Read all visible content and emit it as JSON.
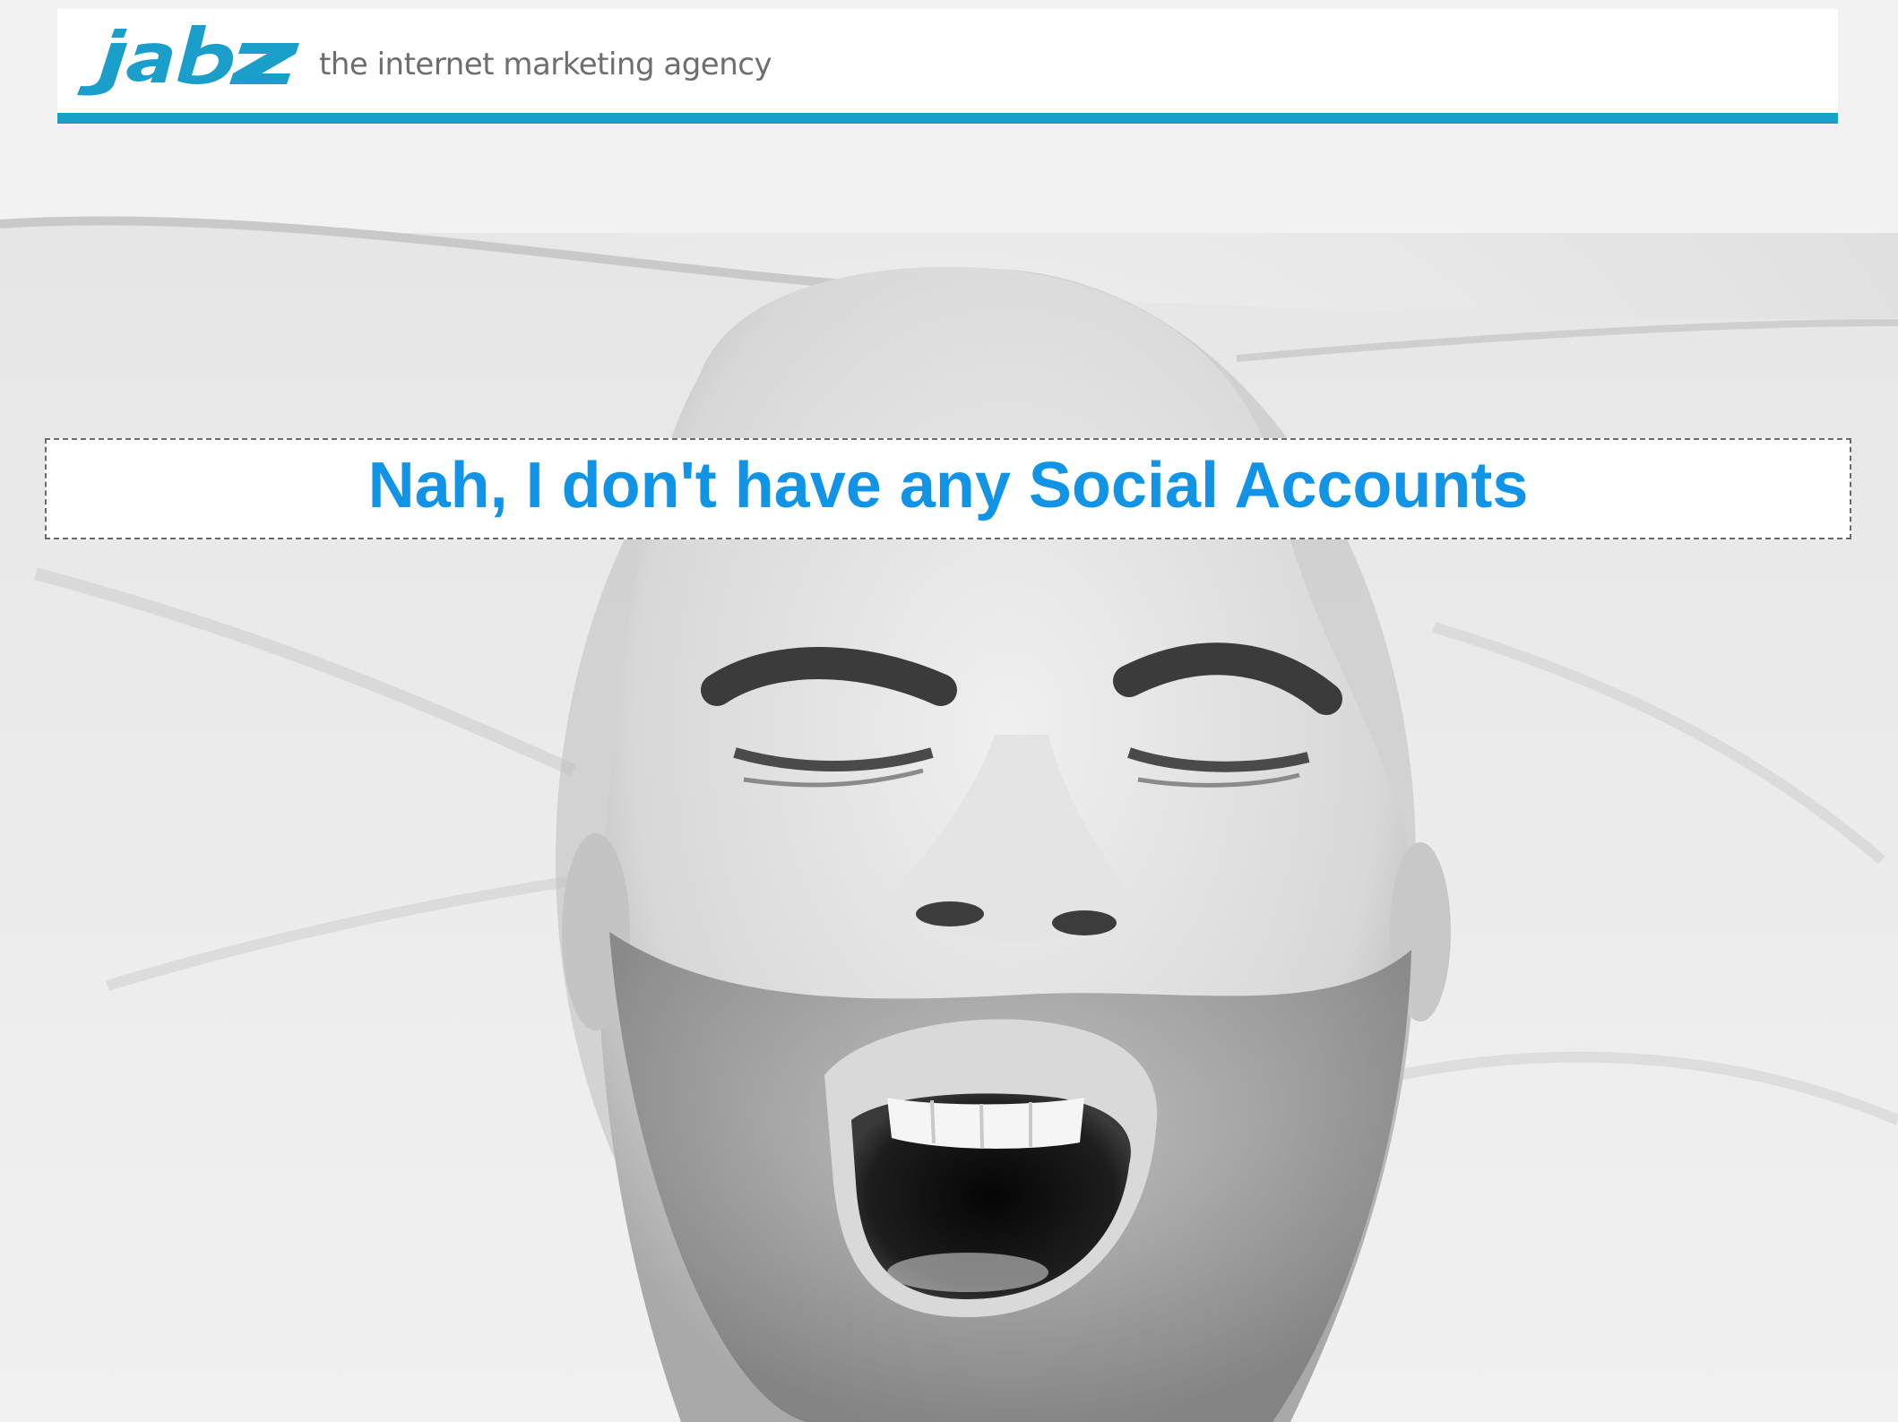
{
  "brand": {
    "logo_text": "jabz",
    "tagline": "the internet marketing agency",
    "accent_color": "#1a9fca"
  },
  "headline": {
    "text": "Nah, I don't have any Social Accounts",
    "color": "#1193e6"
  },
  "background": {
    "icon": "photo-yawning-man-on-pillow"
  }
}
